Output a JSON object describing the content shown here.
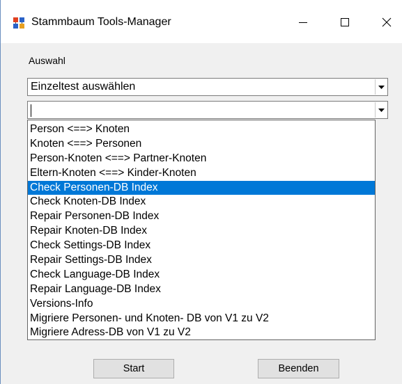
{
  "window": {
    "title": "Stammbaum Tools-Manager",
    "icon": "stammbaum-app-icon",
    "controls": {
      "minimize": "–",
      "maximize": "□",
      "close": "✕"
    }
  },
  "form": {
    "auswahl_label": "Auswahl",
    "combo1_value": "Einzeltest auswählen",
    "combo2_value": ""
  },
  "dropdown": {
    "selected_index": 4,
    "items": [
      "Person <==> Knoten",
      "Knoten <==> Personen",
      "Person-Knoten <==> Partner-Knoten",
      "Eltern-Knoten <==> Kinder-Knoten",
      "Check Personen-DB Index",
      "Check Knoten-DB Index",
      "Repair Personen-DB Index",
      "Repair Knoten-DB Index",
      "Check Settings-DB Index",
      "Repair Settings-DB Index",
      "Check Language-DB Index",
      "Repair Language-DB Index",
      "Versions-Info",
      "Migriere Personen- und Knoten- DB von V1 zu V2",
      "Migriere Adress-DB von V1 zu V2"
    ]
  },
  "buttons": {
    "start": "Start",
    "beenden": "Beenden"
  },
  "colors": {
    "selection": "#0078d7",
    "window_bg": "#f0f0f0"
  }
}
